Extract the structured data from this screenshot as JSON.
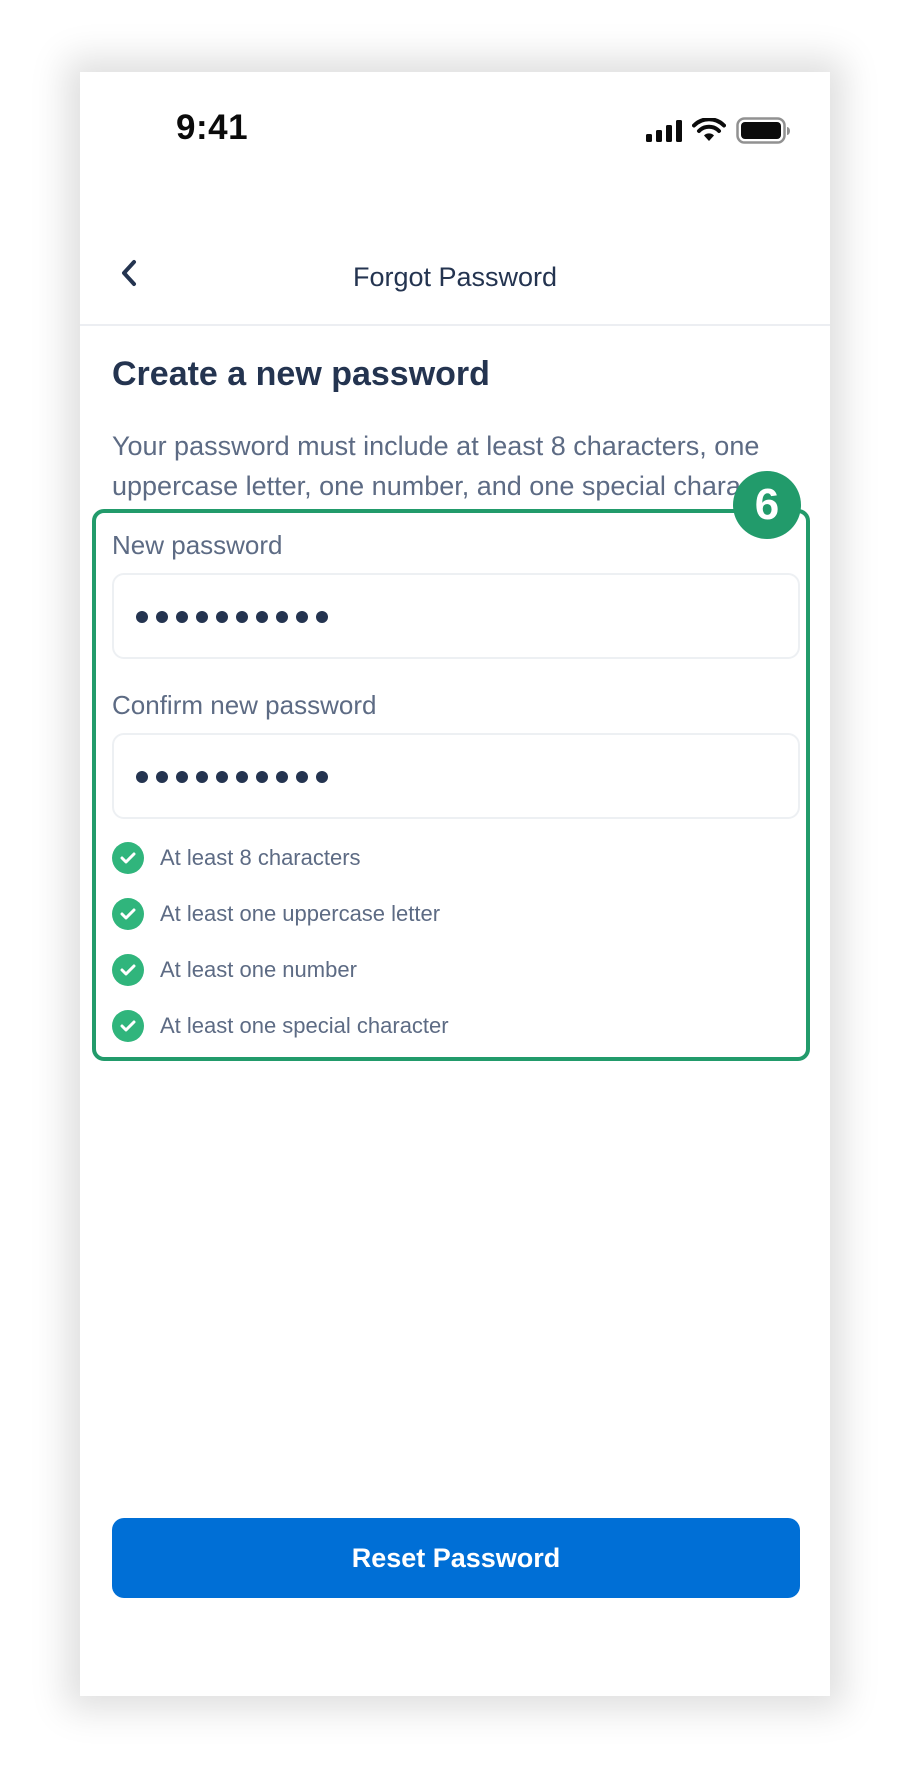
{
  "status_bar": {
    "time": "9:41",
    "icons": [
      "signal-icon",
      "wifi-icon",
      "battery-icon"
    ]
  },
  "nav": {
    "back_icon": "chevron-left-icon",
    "title": "Forgot Password"
  },
  "content": {
    "heading": "Create a new password",
    "description": "Your password must include at least 8 characters, one uppercase letter, one number, and one special character."
  },
  "annotation_badge": "6",
  "form": {
    "new_password": {
      "label": "New password",
      "value": "••••••••••",
      "masked_length": 10
    },
    "confirm_password": {
      "label": "Confirm new password",
      "value": "••••••••••",
      "masked_length": 10
    },
    "requirements": [
      {
        "text": "At least 8 characters",
        "met": true
      },
      {
        "text": "At least one uppercase letter",
        "met": true
      },
      {
        "text": "At least one number",
        "met": true
      },
      {
        "text": "At least one special character",
        "met": true
      }
    ]
  },
  "actions": {
    "reset_label": "Reset Password"
  },
  "colors": {
    "primary": "#006fd6",
    "success": "#30b57c",
    "highlight": "#229b6b",
    "text_dark": "#243450",
    "text_muted": "#5d6b84"
  }
}
